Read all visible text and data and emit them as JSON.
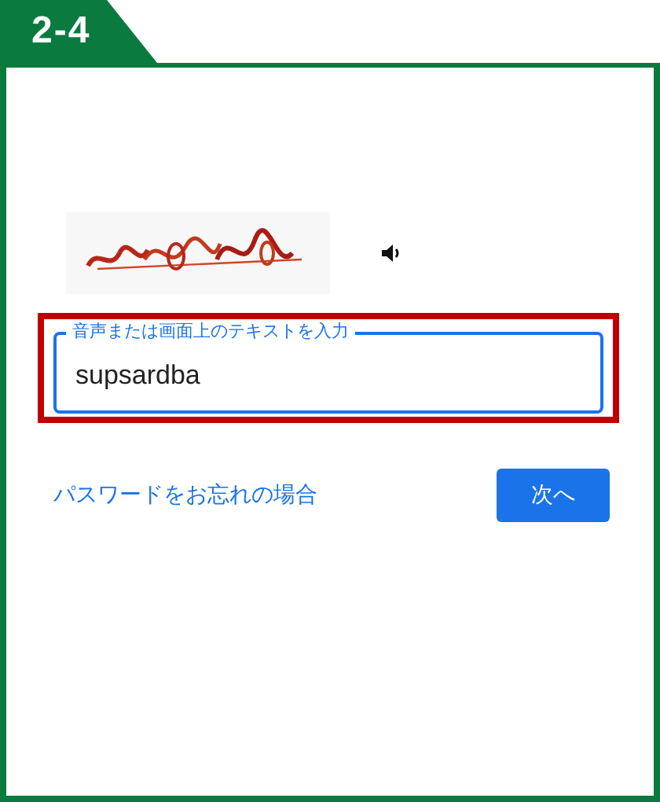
{
  "step_badge": "2-4",
  "answer_field": {
    "label": "音声または画面上のテキストを入力",
    "value": "supsardba",
    "highlighted": true
  },
  "forgot_link": "パスワードをお忘れの場合",
  "next_button": "次へ"
}
